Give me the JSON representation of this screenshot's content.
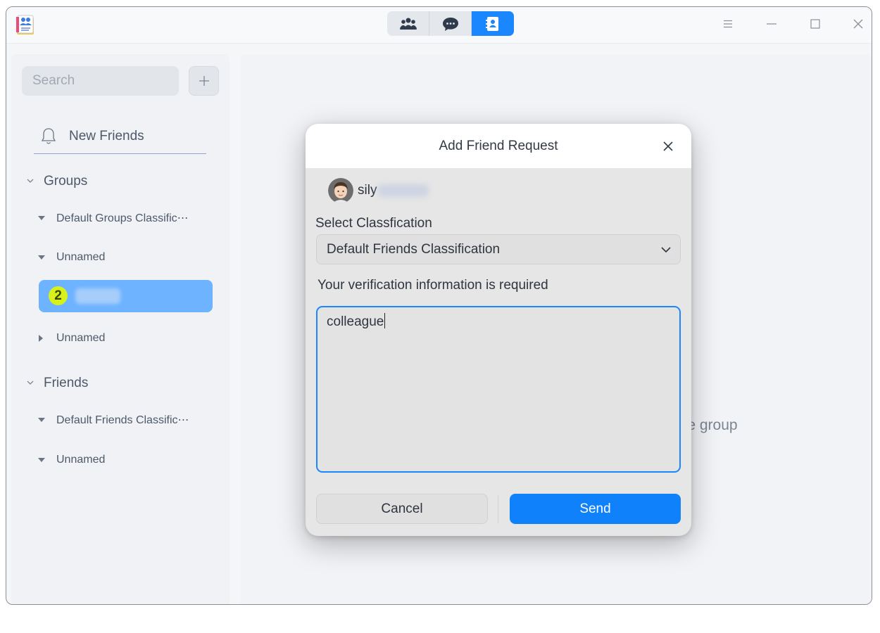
{
  "titlebar": {
    "tabs": [
      {
        "icon": "group-people-icon",
        "active": false
      },
      {
        "icon": "chat-bubble-icon",
        "active": false
      },
      {
        "icon": "contacts-icon",
        "active": true
      }
    ],
    "window_controls": [
      "menu-icon",
      "minimize-icon",
      "maximize-icon",
      "close-icon"
    ]
  },
  "sidebar": {
    "search_placeholder": "Search",
    "new_friends_label": "New Friends",
    "groups": {
      "label": "Groups",
      "items": [
        {
          "label": "Default Groups Classific⋯",
          "expanded": true
        },
        {
          "label": "Unnamed",
          "expanded": true
        },
        {
          "label": "Unnamed",
          "expanded": false
        }
      ],
      "selected_badge": "2"
    },
    "friends": {
      "label": "Friends",
      "items": [
        {
          "label": "Default Friends Classific⋯",
          "expanded": true
        },
        {
          "label": "Unnamed",
          "expanded": true
        }
      ]
    }
  },
  "main": {
    "background_hint": "Create group"
  },
  "dialog": {
    "title": "Add Friend Request",
    "user_name": "sily",
    "classification_label": "Select Classfication",
    "classification_value": "Default Friends Classification",
    "verification_label": "Your verification information is required",
    "verification_text": "colleague",
    "cancel_label": "Cancel",
    "send_label": "Send"
  },
  "colors": {
    "accent": "#1b87ff",
    "selected_row": "#6db3ff",
    "badge": "#d6f21a"
  }
}
